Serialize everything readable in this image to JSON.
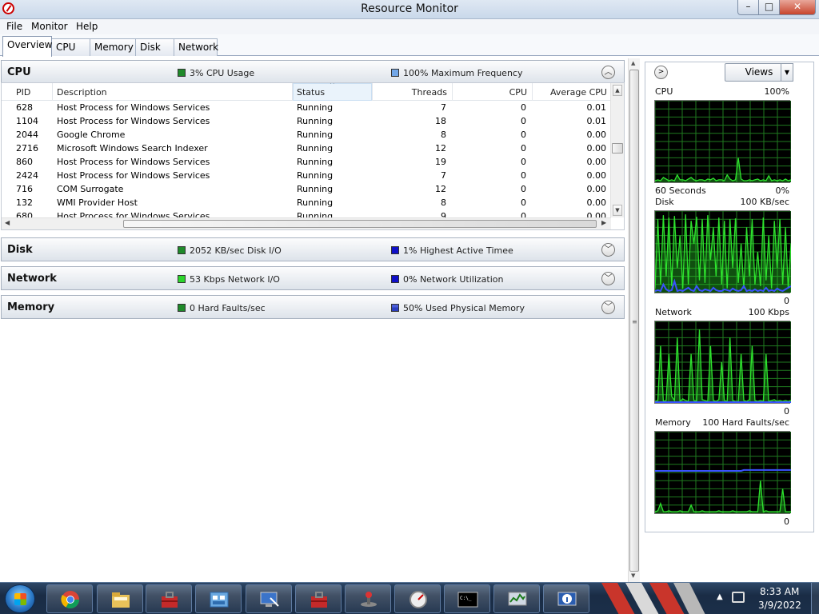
{
  "window": {
    "title": "Resource Monitor",
    "controls": {
      "minimize": "–",
      "maximize": "□",
      "close": "✕"
    }
  },
  "menu": [
    "File",
    "Monitor",
    "Help"
  ],
  "tabs": [
    "Overview",
    "CPU",
    "Memory",
    "Disk",
    "Network"
  ],
  "active_tab": "Overview",
  "sections": {
    "cpu": {
      "title": "CPU",
      "metric1": "3% CPU Usage",
      "metric2": "100% Maximum Frequency",
      "expanded": true
    },
    "disk": {
      "title": "Disk",
      "metric1": "2052 KB/sec Disk I/O",
      "metric2": "1% Highest Active Timee",
      "expanded": false
    },
    "network": {
      "title": "Network",
      "metric1": "53 Kbps Network I/O",
      "metric2": "0% Network Utilization",
      "expanded": false
    },
    "memory": {
      "title": "Memory",
      "metric1": "0 Hard Faults/sec",
      "metric2": "50% Used Physical Memory",
      "expanded": false
    }
  },
  "cpu_table": {
    "columns": [
      "PID",
      "Description",
      "Status",
      "Threads",
      "CPU",
      "Average CPU"
    ],
    "sorted_column": "Status",
    "rows": [
      [
        "628",
        "Host Process for Windows Services",
        "Running",
        "7",
        "0",
        "0.01"
      ],
      [
        "1104",
        "Host Process for Windows Services",
        "Running",
        "18",
        "0",
        "0.01"
      ],
      [
        "2044",
        "Google Chrome",
        "Running",
        "8",
        "0",
        "0.00"
      ],
      [
        "2716",
        "Microsoft Windows Search Indexer",
        "Running",
        "12",
        "0",
        "0.00"
      ],
      [
        "860",
        "Host Process for Windows Services",
        "Running",
        "19",
        "0",
        "0.00"
      ],
      [
        "2424",
        "Host Process for Windows Services",
        "Running",
        "7",
        "0",
        "0.00"
      ],
      [
        "716",
        "COM Surrogate",
        "Running",
        "12",
        "0",
        "0.00"
      ],
      [
        "132",
        "WMI Provider Host",
        "Running",
        "8",
        "0",
        "0.00"
      ],
      [
        "680",
        "Host Process for Windows Services",
        "Running",
        "9",
        "0",
        "0.00"
      ]
    ]
  },
  "graphs_panel": {
    "views_label": "Views",
    "graphs": [
      {
        "name": "CPU",
        "top_right": "100%",
        "bottom_left": "60 Seconds",
        "bottom_right": "0%"
      },
      {
        "name": "Disk",
        "top_right": "100 KB/sec",
        "bottom_left": "",
        "bottom_right": "0"
      },
      {
        "name": "Network",
        "top_right": "100 Kbps",
        "bottom_left": "",
        "bottom_right": "0"
      },
      {
        "name": "Memory",
        "top_right": "100 Hard Faults/sec",
        "bottom_left": "",
        "bottom_right": "0"
      }
    ]
  },
  "taskbar": {
    "time": "8:33 AM",
    "date": "3/9/2022",
    "apps": [
      "chrome-icon",
      "file-explorer-icon",
      "toolbox-icon",
      "control-panel-icon",
      "remote-desktop-icon",
      "toolbox-icon",
      "network-icon",
      "gauge-icon",
      "command-prompt-icon",
      "resource-monitor-icon",
      "system-info-icon"
    ]
  },
  "colors": {
    "graph_bg": "#000000",
    "graph_grid": "#1f7a1f",
    "graph_line_green": "#2ee32e",
    "graph_line_blue": "#3a52ff",
    "taskbar": "#1b2f49"
  }
}
